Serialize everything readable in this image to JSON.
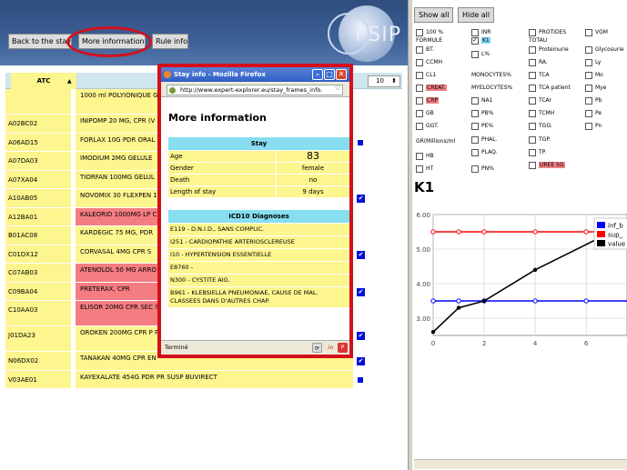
{
  "toolbar": {
    "back_label": "Back to the stay",
    "more_label": "More information",
    "rule_label": "Rule info"
  },
  "logo": {
    "text": "PSIP"
  },
  "table": {
    "atc_header": "ATC",
    "sort_indicator": "▲",
    "count_select": "10",
    "rows": [
      {
        "code": "",
        "drug": "1000 ml POLYIONIQUE G5 SPASFON SOL INJ",
        "color": "y",
        "mark": "",
        "h": "tall2"
      },
      {
        "code": "A02BC02",
        "drug": "INIPOMP 20 MG, CPR (V",
        "color": "y",
        "mark": ""
      },
      {
        "code": "A06AD15",
        "drug": "FORLAX 10G PDR ORAL",
        "color": "y",
        "mark": "sq"
      },
      {
        "code": "A07DA03",
        "drug": "IMODIUM 2MG GELULE",
        "color": "y",
        "mark": ""
      },
      {
        "code": "A07XA04",
        "drug": "TIORFAN 100MG GELUL",
        "color": "y",
        "mark": ""
      },
      {
        "code": "A10AB05",
        "drug": "NOVOMIX 30 FLEXPEN 1",
        "color": "y",
        "mark": "chk"
      },
      {
        "code": "A12BA01",
        "drug": "KALEORID 1000MG LP C",
        "color": "r",
        "mark": ""
      },
      {
        "code": "B01AC08",
        "drug": "KARDEGIC 75 MG, PDR",
        "color": "y",
        "mark": ""
      },
      {
        "code": "C01DX12",
        "drug": "CORVASAL 4MG CPR S",
        "color": "y",
        "mark": "chk"
      },
      {
        "code": "C07AB03",
        "drug": "ATENOLOL 50 MG ARRO",
        "color": "r",
        "mark": ""
      },
      {
        "code": "C09BA04",
        "drug": "PRETERAX, CPR",
        "color": "r",
        "mark": "chk"
      },
      {
        "code": "C10AA03",
        "drug": "ELISOR 20MG CPR SEC SANDOZ",
        "color": "r",
        "mark": "",
        "h": "tall2"
      },
      {
        "code": "J01DA23",
        "drug": "OROKEN 200MG CPR P PAPIER OBLIGATOIRE A",
        "color": "y",
        "mark": "chk",
        "h": "tall2"
      },
      {
        "code": "N06DX02",
        "drug": "TANAKAN 40MG CPR EN",
        "color": "y",
        "mark": "chk"
      },
      {
        "code": "V03AE01",
        "drug": "KAYEXALATE 454G PDR PR SUSP BUVIRECT",
        "color": "y",
        "mark": "sq"
      }
    ]
  },
  "popup": {
    "window_title": "Stay info - Mozilla Firefox",
    "url": "http://www.expert-explorer.eu/stay_frames_info.",
    "heading": "More information",
    "stay_header": "Stay",
    "stay": [
      {
        "k": "Age",
        "v": "83"
      },
      {
        "k": "Gender",
        "v": "female"
      },
      {
        "k": "Death",
        "v": "no"
      },
      {
        "k": "Length of stay",
        "v": "9 days"
      }
    ],
    "icd_header": "ICD10 Diagnoses",
    "icd": [
      "E119 -  D.N.I.D., SANS COMPLIC.",
      "I251 -  CARDIOPATHIE ARTERIOSCLEREUSE",
      "I10 -  HYPERTENSION ESSENTIELLE",
      "E8760 -",
      "N300 -  CYSTITE AIG.",
      "B961 -  KLEBSIELLA PNEUMONIAE, CAUSE DE MAL. CLASSEES DANS D'AUTRES CHAP."
    ],
    "status": "Terminé"
  },
  "right": {
    "show_all": "Show all",
    "hide_all": "Hide all",
    "checkboxes": [
      {
        "label": "100 %",
        "col": 0,
        "row": 0,
        "on": false,
        "style": ""
      },
      {
        "label": "INR",
        "col": 1,
        "row": 0,
        "on": false,
        "style": ""
      },
      {
        "label": "PROTIDES",
        "col": 2,
        "row": 0,
        "on": false,
        "style": ""
      },
      {
        "label": "VGM",
        "col": 3,
        "row": 0,
        "on": false,
        "style": ""
      },
      {
        "label": "BT.",
        "col": 0,
        "row": 2,
        "on": false,
        "style": ""
      },
      {
        "label": "K1",
        "col": 1,
        "row": 1,
        "on": true,
        "style": "blue"
      },
      {
        "label": "Proteinurie",
        "col": 2,
        "row": 2,
        "on": false,
        "style": ""
      },
      {
        "label": "Glycosurie",
        "col": 3,
        "row": 2,
        "on": false,
        "style": ""
      },
      {
        "label": "L%",
        "col": 1,
        "row": 2.5,
        "on": false,
        "style": ""
      },
      {
        "label": "CCMH",
        "col": 0,
        "row": 3.5,
        "on": false,
        "style": ""
      },
      {
        "label": "RA.",
        "col": 2,
        "row": 3.5,
        "on": false,
        "style": ""
      },
      {
        "label": "Ly",
        "col": 3,
        "row": 3.5,
        "on": false,
        "style": ""
      },
      {
        "label": "CL1",
        "col": 0,
        "row": 5,
        "on": false,
        "style": ""
      },
      {
        "label": "TCA",
        "col": 2,
        "row": 5,
        "on": false,
        "style": ""
      },
      {
        "label": "Mo",
        "col": 3,
        "row": 5,
        "on": false,
        "style": ""
      },
      {
        "label": "CREAT.",
        "col": 0,
        "row": 6.5,
        "on": false,
        "style": "red"
      },
      {
        "label": "NA1",
        "col": 1,
        "row": 8,
        "on": false,
        "style": ""
      },
      {
        "label": "TCA patient",
        "col": 2,
        "row": 6.5,
        "on": false,
        "style": ""
      },
      {
        "label": "Mye",
        "col": 3,
        "row": 6.5,
        "on": false,
        "style": ""
      },
      {
        "label": "CRP",
        "col": 0,
        "row": 8,
        "on": false,
        "style": "red"
      },
      {
        "label": "TCAr",
        "col": 2,
        "row": 8,
        "on": false,
        "style": ""
      },
      {
        "label": "Pb",
        "col": 3,
        "row": 8,
        "on": false,
        "style": ""
      },
      {
        "label": "GB",
        "col": 0,
        "row": 9.5,
        "on": false,
        "style": ""
      },
      {
        "label": "PB%",
        "col": 1,
        "row": 9.5,
        "on": false,
        "style": ""
      },
      {
        "label": "TCMH",
        "col": 2,
        "row": 9.5,
        "on": false,
        "style": ""
      },
      {
        "label": "Pe",
        "col": 3,
        "row": 9.5,
        "on": false,
        "style": ""
      },
      {
        "label": "GGT.",
        "col": 0,
        "row": 11,
        "on": false,
        "style": ""
      },
      {
        "label": "PE%",
        "col": 1,
        "row": 11,
        "on": false,
        "style": ""
      },
      {
        "label": "TGO.",
        "col": 2,
        "row": 11,
        "on": false,
        "style": ""
      },
      {
        "label": "Pn",
        "col": 3,
        "row": 11,
        "on": false,
        "style": ""
      },
      {
        "label": "PHAL.",
        "col": 1,
        "row": 12.5,
        "on": false,
        "style": ""
      },
      {
        "label": "TGP.",
        "col": 2,
        "row": 12.5,
        "on": false,
        "style": ""
      },
      {
        "label": "HB",
        "col": 0,
        "row": 14.5,
        "on": false,
        "style": ""
      },
      {
        "label": "PLAQ.",
        "col": 1,
        "row": 14,
        "on": false,
        "style": ""
      },
      {
        "label": "TP.",
        "col": 2,
        "row": 14,
        "on": false,
        "style": ""
      },
      {
        "label": "HT",
        "col": 0,
        "row": 16,
        "on": false,
        "style": ""
      },
      {
        "label": "PN%",
        "col": 1,
        "row": 16,
        "on": false,
        "style": ""
      },
      {
        "label": "UREE SG",
        "col": 2,
        "row": 15.5,
        "on": false,
        "style": "red"
      }
    ],
    "plain_labels": [
      {
        "label": "FORMULE",
        "col": 0,
        "row": 1
      },
      {
        "label": "TOTAU",
        "col": 2,
        "row": 1
      },
      {
        "label": "MONOCYTES%",
        "col": 1,
        "row": 5
      },
      {
        "label": "MYELOCYTES%",
        "col": 1,
        "row": 6.5
      },
      {
        "label": "GR(Millions/ml",
        "col": 0,
        "row": 12.8
      }
    ],
    "chart_title": "K1"
  },
  "chart_data": {
    "type": "line",
    "title": "K1",
    "x": [
      0,
      1,
      2,
      4,
      6,
      7
    ],
    "xlim": [
      0,
      7.6
    ],
    "ylim": [
      2.5,
      6.0
    ],
    "xticks": [
      "0",
      "2",
      "4",
      "6"
    ],
    "yticks": [
      "3.00",
      "4.00",
      "5.00",
      "6.00"
    ],
    "grid": true,
    "legend_position": "top-right",
    "series": [
      {
        "name": "inf_b",
        "color": "#0000ff",
        "points": [
          [
            0,
            3.5
          ],
          [
            1,
            3.5
          ],
          [
            2,
            3.5
          ],
          [
            4,
            3.5
          ],
          [
            6,
            3.5
          ],
          [
            7.6,
            3.5
          ]
        ]
      },
      {
        "name": "sup_",
        "color": "#ff0000",
        "points": [
          [
            0,
            5.5
          ],
          [
            1,
            5.5
          ],
          [
            2,
            5.5
          ],
          [
            4,
            5.5
          ],
          [
            6,
            5.5
          ],
          [
            7,
            5.5
          ]
        ]
      },
      {
        "name": "value",
        "color": "#000000",
        "points": [
          [
            0,
            2.6
          ],
          [
            1,
            3.3
          ],
          [
            2,
            3.5
          ],
          [
            4,
            4.4
          ],
          [
            7,
            5.5
          ]
        ]
      }
    ]
  },
  "colors": {
    "yellow_cell": "#fdf58e",
    "red_cell": "#f47d82",
    "cyan_header": "#86def0",
    "highlight_red": "#d3101b"
  }
}
